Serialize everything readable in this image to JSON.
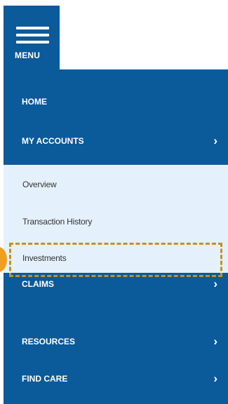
{
  "menu": {
    "label": "MENU",
    "items": [
      {
        "label": "HOME",
        "has_chevron": false
      },
      {
        "label": "MY ACCOUNTS",
        "has_chevron": true,
        "expanded": true
      },
      {
        "label": "CLAIMS",
        "has_chevron": true
      },
      {
        "label": "RESOURCES",
        "has_chevron": true
      },
      {
        "label": "FIND CARE",
        "has_chevron": true
      }
    ],
    "chevron_glyph": "›"
  },
  "submenu": {
    "items": [
      {
        "label": "Overview"
      },
      {
        "label": "Transaction History"
      },
      {
        "label": "Investments",
        "highlighted": true
      }
    ]
  },
  "colors": {
    "primary_blue": "#0b5a9a",
    "submenu_bg": "#e4f0fb",
    "highlight_border": "#c8901e",
    "pointer": "#f0a020"
  }
}
